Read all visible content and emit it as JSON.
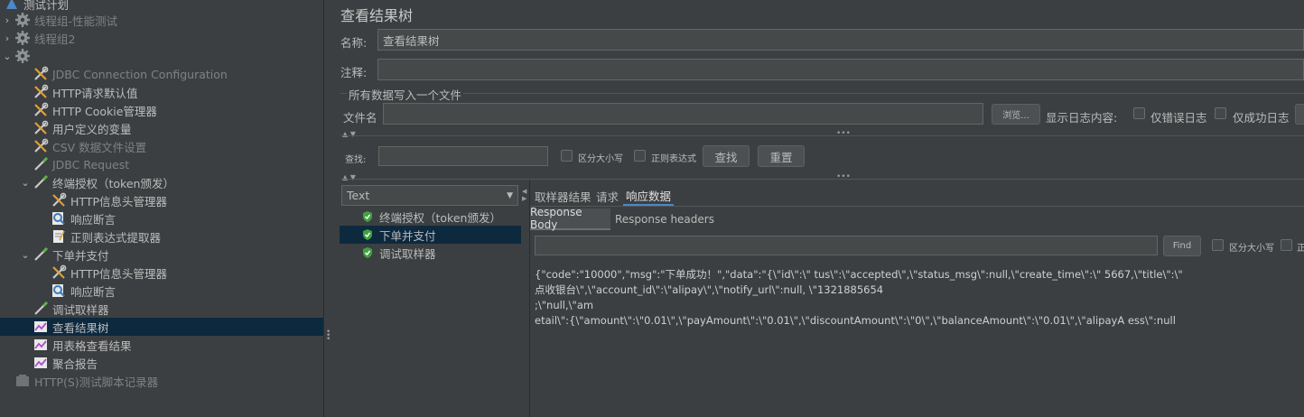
{
  "tree": {
    "root": "测试计划",
    "items": [
      {
        "label": "线程组-性能测试",
        "depth": 0,
        "twisty": "›",
        "icon": "gear-icon",
        "disabled": true
      },
      {
        "label": "线程组2",
        "depth": 0,
        "twisty": "›",
        "icon": "gear-icon",
        "disabled": true
      },
      {
        "label": "",
        "depth": 0,
        "twisty": "⌄",
        "icon": "gear-icon",
        "disabled": false
      },
      {
        "label": "JDBC Connection Configuration",
        "depth": 1,
        "icon": "wrench-icon",
        "disabled": true
      },
      {
        "label": "HTTP请求默认值",
        "depth": 1,
        "icon": "wrench-icon",
        "disabled": false
      },
      {
        "label": "HTTP Cookie管理器",
        "depth": 1,
        "icon": "wrench-icon",
        "disabled": false
      },
      {
        "label": "用户定义的变量",
        "depth": 1,
        "icon": "wrench-icon",
        "disabled": false
      },
      {
        "label": "CSV 数据文件设置",
        "depth": 1,
        "icon": "wrench-icon",
        "disabled": true
      },
      {
        "label": "JDBC Request",
        "depth": 1,
        "icon": "pipette-icon",
        "disabled": true
      },
      {
        "label": "终端授权（token颁发）",
        "depth": 1,
        "twisty": "⌄",
        "icon": "pipette-icon",
        "disabled": false
      },
      {
        "label": "HTTP信息头管理器",
        "depth": 2,
        "icon": "wrench-icon",
        "disabled": false
      },
      {
        "label": "响应断言",
        "depth": 2,
        "icon": "magnifier-icon",
        "disabled": false
      },
      {
        "label": "正则表达式提取器",
        "depth": 2,
        "icon": "document-icon",
        "disabled": false
      },
      {
        "label": "下单并支付",
        "depth": 1,
        "twisty": "⌄",
        "icon": "pipette-icon",
        "disabled": false
      },
      {
        "label": "HTTP信息头管理器",
        "depth": 2,
        "icon": "wrench-icon",
        "disabled": false
      },
      {
        "label": "响应断言",
        "depth": 2,
        "icon": "magnifier-icon",
        "disabled": false
      },
      {
        "label": "调试取样器",
        "depth": 1,
        "icon": "pipette-icon",
        "disabled": false
      },
      {
        "label": "查看结果树",
        "depth": 1,
        "icon": "chart-icon",
        "disabled": false,
        "selected": true
      },
      {
        "label": "用表格查看结果",
        "depth": 1,
        "icon": "chart-icon",
        "disabled": false
      },
      {
        "label": "聚合报告",
        "depth": 1,
        "icon": "chart-icon",
        "disabled": false
      },
      {
        "label": "HTTP(S)测试脚本记录器",
        "depth": 0,
        "icon": "recorder-icon",
        "disabled": true
      }
    ]
  },
  "panel": {
    "title": "查看结果树",
    "name_label": "名称:",
    "name_value": "查看结果树",
    "comment_label": "注释:",
    "comment_value": "",
    "file_section": "所有数据写入一个文件",
    "file_label": "文件名",
    "file_value": "",
    "browse_label": "浏览...",
    "log_label": "显示日志内容:",
    "errors_only": "仅错误日志",
    "success_only": "仅成功日志",
    "search_label": "查找:",
    "search_value": "",
    "case_label": "区分大小写",
    "regex_label": "正则表达式",
    "find_btn": "查找",
    "reset_btn": "重置",
    "renderer": "Text",
    "results": [
      {
        "label": "终端授权（token颁发）",
        "selected": false
      },
      {
        "label": "下单并支付",
        "selected": true
      },
      {
        "label": "调试取样器",
        "selected": false
      }
    ],
    "tabs": [
      "取样器结果",
      "请求",
      "响应数据"
    ],
    "active_tab": "响应数据",
    "subtabs": [
      "Response Body",
      "Response headers"
    ],
    "body_find_value": "",
    "body_find_btn": "Find",
    "body_case_label": "区分大小写",
    "body_regex_label": "正",
    "response_lines": [
      "{\"code\":\"10000\",\"msg\":\"下单成功！\",\"data\":\"{\\\"id\\\":\\\"              tus\\\":\\\"accepted\\\",\\\"status_msg\\\":null,\\\"create_time\\\":\\\"              5667,\\\"title\\\":\\\"",
      "点收银台\\\",\\\"account_id\\\":\\\"alipay\\\",\\\"notify_url\\\":null,                                              \\\"1321885654",
      "                                              ;\\\"null,\\\"am",
      "etail\\\":{\\\"amount\\\":\\\"0.01\\\",\\\"payAmount\\\":\\\"0.01\\\",\\\"discountAmount\\\":\\\"0\\\",\\\"balanceAmount\\\":\\\"0.01\\\",\\\"alipayA                      ess\\\":null"
    ]
  }
}
